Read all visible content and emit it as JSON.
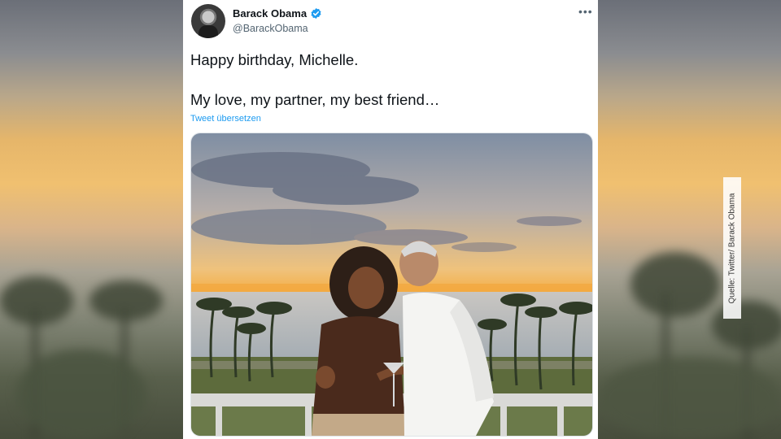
{
  "tweet": {
    "display_name": "Barack Obama",
    "handle": "@BarackObama",
    "verified_icon": "verified-badge-icon",
    "more_icon": "more-options-icon",
    "more_glyph": "•••",
    "text_line1": "Happy birthday, Michelle.",
    "text_line2": "My love, my partner, my best friend…",
    "translate_label": "Tweet übersetzen"
  },
  "overlay": {
    "source_credit": "Quelle: Twitter/ Barack Obama"
  },
  "colors": {
    "link": "#1d9bf0",
    "text_primary": "#0f1419",
    "text_secondary": "#536471"
  }
}
